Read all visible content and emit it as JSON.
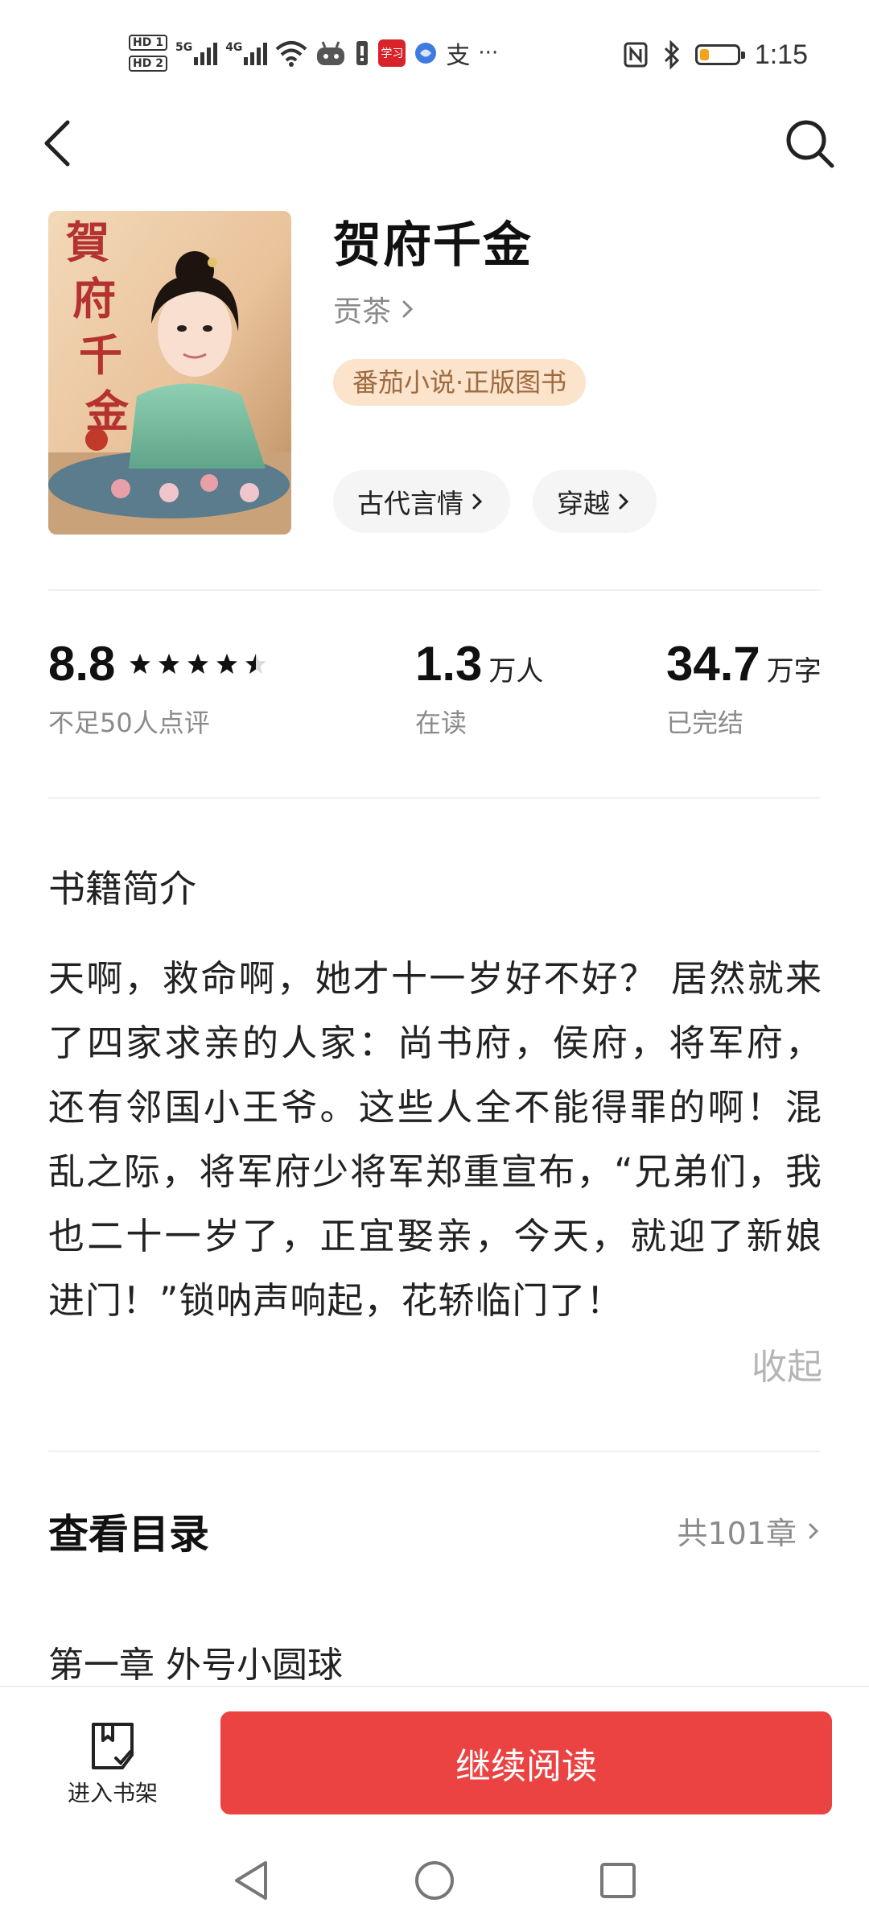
{
  "status_bar": {
    "hd1": "HD 1",
    "hd2": "HD 2",
    "sig1": "5G",
    "sig2": "4G",
    "app_label": "学习",
    "alipay": "支",
    "more": "···",
    "time": "1:15",
    "battery_level": 0.25,
    "battery_color": "#f5a21b"
  },
  "nav": {
    "back_icon": "chevron-left-icon",
    "search_icon": "search-icon"
  },
  "book": {
    "title": "贺府千金",
    "author": "贡茶",
    "badge": "番茄小说·正版图书",
    "cover_text": "賀府千金",
    "tags": [
      {
        "label": "古代言情"
      },
      {
        "label": "穿越"
      }
    ]
  },
  "stats": {
    "rating": "8.8",
    "rating_stars": 4.5,
    "rating_sub": "不足50人点评",
    "readers": "1.3",
    "readers_unit": "万人",
    "readers_sub": "在读",
    "words": "34.7",
    "words_unit": "万字",
    "words_sub": "已完结"
  },
  "intro": {
    "title": "书籍简介",
    "text": "天啊，救命啊，她才十一岁好不好？ 居然就来了四家求亲的人家：尚书府，侯府，将军府，还有邻国小王爷。这些人全不能得罪的啊！混乱之际，将军府少将军郑重宣布，“兄弟们，我也二十一岁了，正宜娶亲，今天，就迎了新娘进门！”锁呐声响起，花轿临门了！",
    "collapse": "收起"
  },
  "toc": {
    "title": "查看目录",
    "count": "共101章",
    "first_chapter": "第一章 外号小圆球"
  },
  "bottom": {
    "shelf_label": "进入书架",
    "read_label": "继续阅读",
    "accent": "#eb4242"
  }
}
